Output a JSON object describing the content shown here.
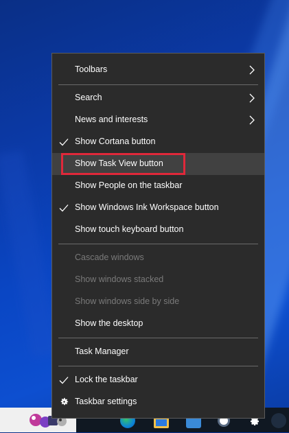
{
  "menu": {
    "items": [
      {
        "label": "Toolbars"
      },
      {
        "label": "Search"
      },
      {
        "label": "News and interests"
      },
      {
        "label": "Show Cortana button"
      },
      {
        "label": "Show Task View button"
      },
      {
        "label": "Show People on the taskbar"
      },
      {
        "label": "Show Windows Ink Workspace button"
      },
      {
        "label": "Show touch keyboard button"
      },
      {
        "label": "Cascade windows"
      },
      {
        "label": "Show windows stacked"
      },
      {
        "label": "Show windows side by side"
      },
      {
        "label": "Show the desktop"
      },
      {
        "label": "Task Manager"
      },
      {
        "label": "Lock the taskbar"
      },
      {
        "label": "Taskbar settings"
      }
    ]
  },
  "colors": {
    "menu_bg": "#2b2b2b",
    "hover_bg": "#414141",
    "highlight": "#e0283a",
    "disabled_text": "#7a7a7a"
  },
  "taskbar": {
    "icons": [
      "game-icon",
      "edge-icon",
      "file-explorer-icon",
      "mail-icon",
      "store-icon",
      "settings-icon"
    ]
  }
}
